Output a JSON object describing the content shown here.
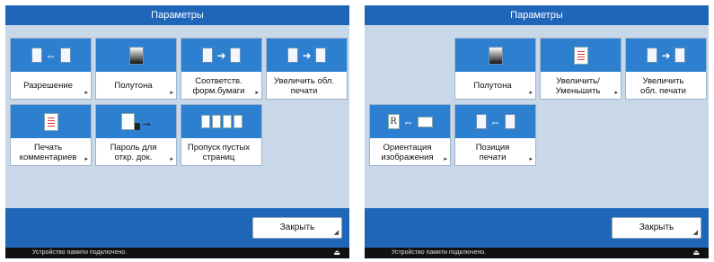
{
  "left_panel": {
    "title": "Параметры",
    "tiles": [
      {
        "label": "Разрешение",
        "icon": "resolution-icon"
      },
      {
        "label": "Полутона",
        "icon": "halftone-icon"
      },
      {
        "label": "Соответств.\nформ.бумаги",
        "icon": "paper-match-icon"
      },
      {
        "label": "Увеличить обл.\nпечати",
        "icon": "enlarge-area-icon"
      },
      {
        "label": "Печать\nкомментариев",
        "icon": "comment-print-icon"
      },
      {
        "label": "Пароль для\nоткр. док.",
        "icon": "password-lock-icon"
      },
      {
        "label": "Пропуск пустых\nстраниц",
        "icon": "skip-blank-icon"
      }
    ],
    "close_label": "Закрыть",
    "status_text": "Устройство памяти подключено."
  },
  "right_panel": {
    "title": "Параметры",
    "tiles": [
      {
        "label": "Полутона",
        "icon": "halftone-icon"
      },
      {
        "label": "Увеличить/\nУменьшить",
        "icon": "zoom-icon"
      },
      {
        "label": "Увеличить\nобл. печати",
        "icon": "enlarge-area-icon"
      },
      {
        "label": "Ориентация\nизображения",
        "icon": "orientation-icon"
      },
      {
        "label": "Позиция\nпечати",
        "icon": "print-position-icon"
      }
    ],
    "close_label": "Закрыть",
    "status_text": "Устройство памяти подключено."
  },
  "colors": {
    "titlebar": "#1f66b8",
    "panel_bg": "#c9d8e8",
    "tile_header": "#2d7fd0"
  }
}
